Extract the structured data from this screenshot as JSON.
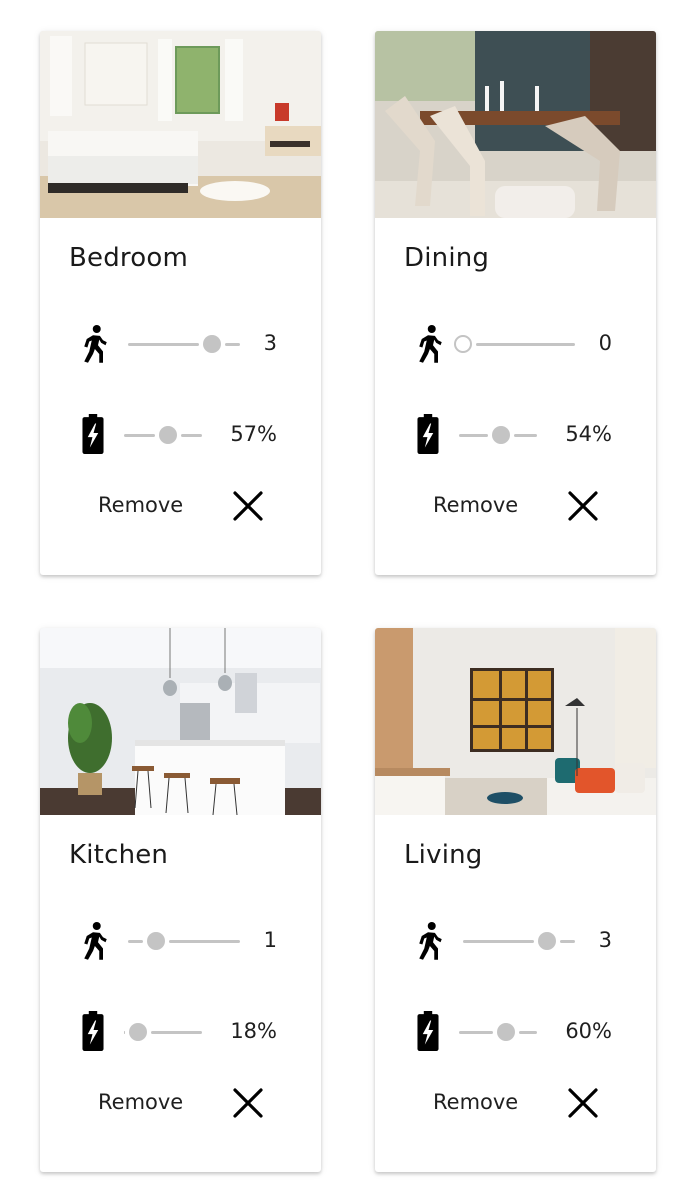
{
  "accent": {
    "track": "#c4c4c4",
    "text": "#1f1f1f"
  },
  "icons": {
    "motion": "walking-person-icon",
    "battery": "battery-charging-icon",
    "remove": "close-icon"
  },
  "rooms": [
    {
      "name": "Bedroom",
      "motion": "3",
      "motion_level": 0.75,
      "battery": "57%",
      "battery_level": 0.57,
      "remove_label": "Remove"
    },
    {
      "name": "Dining",
      "motion": "0",
      "motion_level": 0.0,
      "battery": "54%",
      "battery_level": 0.54,
      "remove_label": "Remove"
    },
    {
      "name": "Kitchen",
      "motion": "1",
      "motion_level": 0.25,
      "battery": "18%",
      "battery_level": 0.18,
      "remove_label": "Remove"
    },
    {
      "name": "Living",
      "motion": "3",
      "motion_level": 0.75,
      "battery": "60%",
      "battery_level": 0.6,
      "remove_label": "Remove"
    }
  ]
}
